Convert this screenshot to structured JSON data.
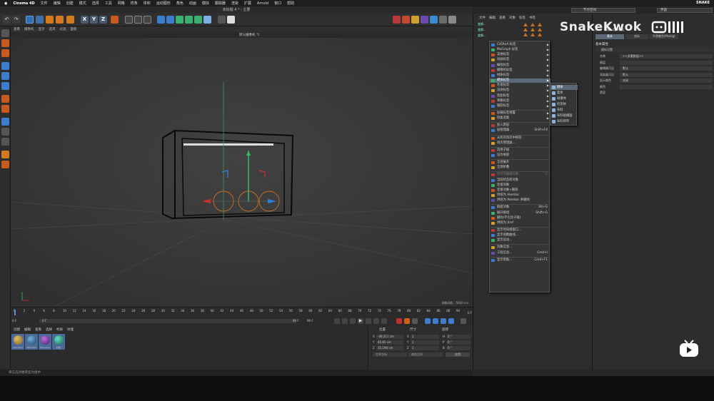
{
  "mac_menu": {
    "app": "Cinema 4D",
    "items": [
      "文件",
      "编辑",
      "创建",
      "模式",
      "选择",
      "工具",
      "网格",
      "样条",
      "体积",
      "运动图形",
      "角色",
      "动画",
      "模拟",
      "跟踪器",
      "渲染",
      "扩展",
      "Arnold",
      "窗口",
      "帮助"
    ],
    "right_label": "SNAKE"
  },
  "window_title": "未标题 4 * - 主要",
  "layout_dropdown": "节点空间",
  "interface_dropdown": "界面",
  "watermark": "SnakeKwok",
  "toolbar_axes": [
    "X",
    "Y",
    "Z"
  ],
  "viewport": {
    "menu": [
      "查看",
      "摄像机",
      "显示",
      "选项",
      "过滤",
      "面板"
    ],
    "camera_label": "默认摄像机 ℃",
    "grid_spacing": "网格间距 : 5000 cm"
  },
  "timeline": {
    "ticks": [
      "0",
      "2",
      "4",
      "6",
      "8",
      "10",
      "12",
      "14",
      "16",
      "18",
      "20",
      "22",
      "24",
      "26",
      "28",
      "30",
      "32",
      "34",
      "36",
      "38",
      "40",
      "42",
      "44",
      "46",
      "48",
      "50",
      "52",
      "54",
      "56",
      "58",
      "60",
      "62",
      "64",
      "66",
      "68",
      "70",
      "72",
      "74",
      "76",
      "78",
      "80",
      "82",
      "84",
      "86",
      "88",
      "90"
    ],
    "current_frame": "0 F",
    "end_frame": "0 F",
    "start_field": "0 F",
    "mid_field": "0 F",
    "max_field": "90 F",
    "max_field2": "90 F",
    "frame_marker": "0 F"
  },
  "material_manager": {
    "menu": [
      "创建",
      "编辑",
      "查看",
      "选择",
      "材质",
      "纹理"
    ],
    "materials": [
      "Standard",
      "Standard",
      "Standard",
      "材质"
    ]
  },
  "coordinates": {
    "headers": [
      "位置",
      "尺寸",
      "旋转"
    ],
    "rows": [
      {
        "axis": "X",
        "pos": "-49.211 cm",
        "size_axis": "X",
        "size": "1",
        "rot_axis": "H",
        "rot": "0 °"
      },
      {
        "axis": "Y",
        "pos": "45.85 cm",
        "size_axis": "Y",
        "size": "1",
        "rot_axis": "P",
        "rot": "0 °"
      },
      {
        "axis": "Z",
        "pos": "35.196 cm",
        "size_axis": "Z",
        "size": "1",
        "rot_axis": "B",
        "rot": "0 °"
      }
    ],
    "mode_dropdown": "世界坐标",
    "scale_dropdown": "缩放比例",
    "apply_button": "应用"
  },
  "status": "将已选对象转变为组中",
  "object_manager": {
    "menu": [
      "文件",
      "编辑",
      "查看",
      "对象",
      "标签",
      "书签"
    ],
    "objects": [
      "变换...",
      "变换...",
      "变换..."
    ]
  },
  "context_menu": {
    "items": [
      {
        "label": "C4DtoA 标签",
        "type": "sub"
      },
      {
        "label": "MoGraph 标签",
        "type": "sub"
      },
      {
        "label": "其他标签",
        "type": "sub"
      },
      {
        "label": "动画标签",
        "type": "sub"
      },
      {
        "label": "编程标签",
        "type": "sub"
      },
      {
        "label": "摄像机标签",
        "type": "sub"
      },
      {
        "label": "材质标签",
        "type": "sub"
      },
      {
        "label": "模拟标签",
        "type": "sub",
        "hl": true
      },
      {
        "label": "毛发标签",
        "type": "sub"
      },
      {
        "label": "渲染标签",
        "type": "sub"
      },
      {
        "label": "装配标签",
        "type": "sub"
      },
      {
        "label": "骨骼标签",
        "type": "sub"
      },
      {
        "label": "跟踪标签",
        "type": "sub"
      },
      {
        "label": "",
        "type": "sep"
      },
      {
        "label": "加载标签预置",
        "type": "sub"
      },
      {
        "label": "恢复选集",
        "type": "sub"
      },
      {
        "label": "",
        "type": "sep"
      },
      {
        "label": "加入新层",
        "type": "item"
      },
      {
        "label": "层管理器...",
        "type": "item",
        "sc": "Shift+F4"
      },
      {
        "label": "",
        "type": "sep"
      },
      {
        "label": "从所有场次中移除",
        "type": "item"
      },
      {
        "label": "场次管理器...",
        "type": "item"
      },
      {
        "label": "",
        "type": "sep"
      },
      {
        "label": "选择子级",
        "type": "item"
      },
      {
        "label": "设为根部",
        "type": "item"
      },
      {
        "label": "",
        "type": "sep"
      },
      {
        "label": "全部展开",
        "type": "item"
      },
      {
        "label": "全部折叠",
        "type": "item"
      },
      {
        "label": "",
        "type": "sep"
      },
      {
        "label": "转为可编辑对象",
        "type": "item",
        "dis": true,
        "sc": "C"
      },
      {
        "label": "当前状态转对象",
        "type": "item"
      },
      {
        "label": "连接对象",
        "type": "item"
      },
      {
        "label": "连接对象+删除",
        "type": "item"
      },
      {
        "label": "烘焙为 Alembic",
        "type": "item"
      },
      {
        "label": "烘焙为 Alembic 并删除",
        "type": "item"
      },
      {
        "label": "",
        "type": "sep"
      },
      {
        "label": "群组对象",
        "type": "item",
        "sc": "Alt+G"
      },
      {
        "label": "展开群组",
        "type": "item",
        "sc": "Shift+G"
      },
      {
        "label": "删除(不包含子级)",
        "type": "item"
      },
      {
        "label": "烘焙为 Xref",
        "type": "item"
      },
      {
        "label": "",
        "type": "sep"
      },
      {
        "label": "显示时间线窗口...",
        "type": "item"
      },
      {
        "label": "显示函数曲线...",
        "type": "item"
      },
      {
        "label": "显示运动...",
        "type": "item"
      },
      {
        "label": "",
        "type": "sep"
      },
      {
        "label": "对象信息...",
        "type": "item"
      },
      {
        "label": "工程信息...",
        "type": "item",
        "sc": "Cmd+I"
      },
      {
        "label": "",
        "type": "sep"
      },
      {
        "label": "显示帮助...",
        "type": "item",
        "sc": "Cmd+F1"
      }
    ]
  },
  "submenu": {
    "items": [
      "刚体",
      "柔体",
      "碰撞体",
      "检测体",
      "布料",
      "布料碰撞器",
      "布料绑带"
    ]
  },
  "attributes": {
    "menu": [
      "模式",
      "编辑",
      "用户数据"
    ],
    "tabs": [
      "基本",
      "坐标",
      "平滑着色(Phong)"
    ],
    "section": "基本属性",
    "group": "图标设置",
    "fields": [
      {
        "label": "名称",
        "value": "<<多重数值>>"
      },
      {
        "label": "图层",
        "value": ""
      },
      {
        "label": "编辑器可见",
        "value": "默认"
      },
      {
        "label": "渲染器可见",
        "value": "默认"
      },
      {
        "label": "显示颜色",
        "value": "关闭"
      },
      {
        "label": "颜色",
        "value": ""
      },
      {
        "label": "透显",
        "value": ""
      }
    ]
  },
  "colors": {
    "accent": "#5a6878",
    "axis_x": "#d03030",
    "axis_y": "#30c060",
    "axis_z": "#3080e0"
  }
}
